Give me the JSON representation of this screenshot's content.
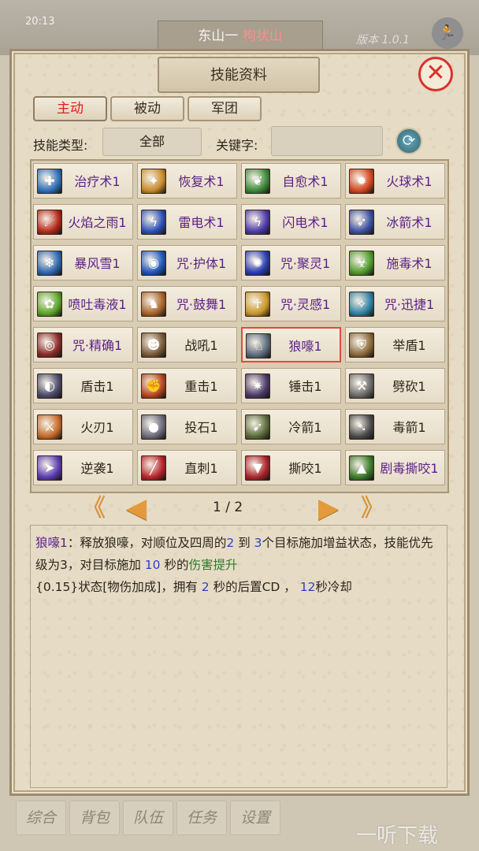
{
  "background": {
    "time": "20:13",
    "location_prefix": "东山一",
    "location_highlight": "枸状山",
    "right_text": "版本 1.0.1",
    "run_icon": "runner-icon"
  },
  "dialog": {
    "title": "技能资料",
    "close_icon": "close-icon"
  },
  "tabs": [
    {
      "label": "主动",
      "active": true
    },
    {
      "label": "被动",
      "active": false
    },
    {
      "label": "军团",
      "active": false
    }
  ],
  "filter": {
    "type_label": "技能类型:",
    "type_value": "全部",
    "keyword_label": "关键字:",
    "keyword_value": ""
  },
  "skills": [
    {
      "label": "治疗术1",
      "icon": "heal-icon",
      "color": "#2f6fb8",
      "glyph": "✚"
    },
    {
      "label": "恢复术1",
      "icon": "restore-icon",
      "color": "#c98a2a",
      "glyph": "✦"
    },
    {
      "label": "自愈术1",
      "icon": "self-heal-icon",
      "color": "#3d8a3a",
      "glyph": "❦"
    },
    {
      "label": "火球术1",
      "icon": "fireball-icon",
      "color": "#d2461e",
      "glyph": "✹"
    },
    {
      "label": "火焰之雨1",
      "icon": "fire-rain-icon",
      "color": "#b3281a",
      "glyph": "☄"
    },
    {
      "label": "雷电术1",
      "icon": "thunder-icon",
      "color": "#2a4fb5",
      "glyph": "ϟ"
    },
    {
      "label": "闪电术1",
      "icon": "lightning-icon",
      "color": "#4b3aa8",
      "glyph": "ϟ"
    },
    {
      "label": "冰箭术1",
      "icon": "ice-arrow-icon",
      "color": "#3b4fa0",
      "glyph": "➶"
    },
    {
      "label": "暴风雪1",
      "icon": "blizzard-icon",
      "color": "#2d66b0",
      "glyph": "❄"
    },
    {
      "label": "咒·护体1",
      "icon": "shield-spell-icon",
      "color": "#1e56b8",
      "glyph": "◉"
    },
    {
      "label": "咒·聚灵1",
      "icon": "spirit-gather-icon",
      "color": "#2a3db0",
      "glyph": "✺"
    },
    {
      "label": "施毒术1",
      "icon": "poison-icon",
      "color": "#4f9a2a",
      "glyph": "☣"
    },
    {
      "label": "喷吐毒液1",
      "icon": "spit-venom-icon",
      "color": "#5ca52a",
      "glyph": "✿"
    },
    {
      "label": "咒·鼓舞1",
      "icon": "inspire-icon",
      "color": "#a8632a",
      "glyph": "♞"
    },
    {
      "label": "咒·灵感1",
      "icon": "insight-icon",
      "color": "#c9962a",
      "glyph": "☥"
    },
    {
      "label": "咒·迅捷1",
      "icon": "swift-icon",
      "color": "#2d7fa0",
      "glyph": "✧"
    },
    {
      "label": "咒·精确1",
      "icon": "precision-icon",
      "color": "#8a2a2a",
      "glyph": "◎"
    },
    {
      "label": "战吼1",
      "icon": "warcry-icon",
      "color": "#7a5a3a",
      "glyph": "☻"
    },
    {
      "label": "狼嚎1",
      "icon": "wolf-howl-icon",
      "color": "#5a6a7a",
      "glyph": "♘"
    },
    {
      "label": "举盾1",
      "icon": "raise-shield-icon",
      "color": "#8a6a3a",
      "glyph": "⛨"
    },
    {
      "label": "盾击1",
      "icon": "shield-bash-icon",
      "color": "#4a4a6a",
      "glyph": "◐"
    },
    {
      "label": "重击1",
      "icon": "heavy-strike-icon",
      "color": "#b5451e",
      "glyph": "✊"
    },
    {
      "label": "锤击1",
      "icon": "hammer-icon",
      "color": "#4a3a6a",
      "glyph": "✷"
    },
    {
      "label": "劈砍1",
      "icon": "cleave-icon",
      "color": "#6a6a6a",
      "glyph": "⚒"
    },
    {
      "label": "火刃1",
      "icon": "fire-blade-icon",
      "color": "#c56a2a",
      "glyph": "⚔"
    },
    {
      "label": "投石1",
      "icon": "throw-stone-icon",
      "color": "#6a6a7a",
      "glyph": "●"
    },
    {
      "label": "冷箭1",
      "icon": "cold-arrow-icon",
      "color": "#5a6a3a",
      "glyph": "➹"
    },
    {
      "label": "毒箭1",
      "icon": "poison-arrow-icon",
      "color": "#4a4a4a",
      "glyph": "➴"
    },
    {
      "label": "逆袭1",
      "icon": "counter-icon",
      "color": "#5a3ab0",
      "glyph": "➤"
    },
    {
      "label": "直刺1",
      "icon": "thrust-icon",
      "color": "#b5232a",
      "glyph": "╱"
    },
    {
      "label": "撕咬1",
      "icon": "bite-icon",
      "color": "#a8232a",
      "glyph": "▼"
    },
    {
      "label": "剧毒撕咬1",
      "icon": "venom-bite-icon",
      "color": "#3a7a2a",
      "glyph": "▲"
    }
  ],
  "selected_index": 18,
  "pager": {
    "first_icon": "double-left-icon",
    "prev_icon": "left-arrow-icon",
    "next_icon": "right-arrow-icon",
    "last_icon": "double-right-icon",
    "indicator": "1 / 2"
  },
  "description": {
    "name": "狼嚎1",
    "t1": "：释放狼嚎，对顺位及四周的",
    "n1": "2",
    "t2": " 到 ",
    "n2": "3",
    "t3": "个目标施加增益状态，技能优先级为3，对目标施加 ",
    "n3": "10",
    "t4": " 秒的",
    "effect": "伤害提升",
    "t5": "{0.15}状态[物伤加成]，拥有 ",
    "n4": "2",
    "t6": " 秒的后置CD ， ",
    "n5": "12",
    "t7": "秒冷却"
  },
  "bottom_tabs": [
    "综合",
    "背包",
    "队伍",
    "任务",
    "设置"
  ],
  "watermark": "一听下载"
}
